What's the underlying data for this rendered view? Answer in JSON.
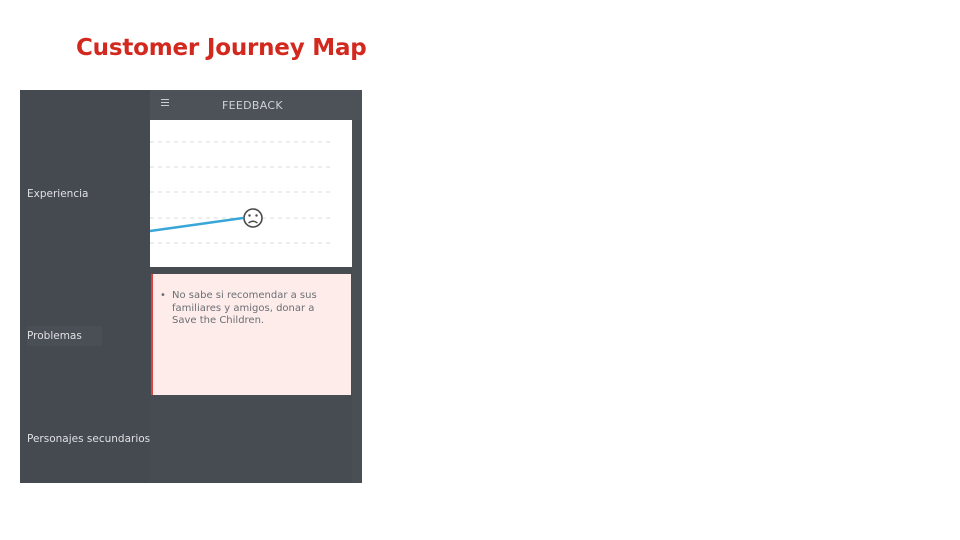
{
  "slide": {
    "title": "Customer Journey Map"
  },
  "journey": {
    "rows": {
      "experience": "Experiencia",
      "problems": "Problemas",
      "secondary_characters": "Personajes secundarios"
    },
    "stage": {
      "title": "FEEDBACK",
      "menu_icon": "hamburger-menu-icon"
    },
    "experience": {
      "mood": "sad",
      "mood_icon": "sad-face-icon",
      "line_color": "#3aa6d8"
    },
    "problems": {
      "items": [
        "No sabe si recomendar a sus familiares y amigos, donar a Save the Children."
      ]
    }
  }
}
